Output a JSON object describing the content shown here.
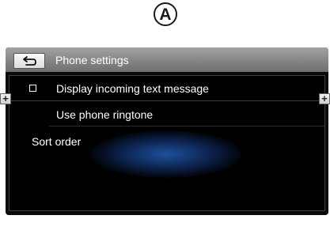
{
  "marker": {
    "label": "A"
  },
  "header": {
    "title": "Phone settings",
    "back_icon": "back-arrow-icon"
  },
  "menu": {
    "items": [
      {
        "label": "Display incoming text message",
        "checked": false
      },
      {
        "label": "Use phone ringtone"
      },
      {
        "label": "Sort order"
      }
    ]
  },
  "side_buttons": {
    "left": "+",
    "right": "+"
  },
  "colors": {
    "screen_background": "#0b0b0b",
    "titlebar": "#8a8a8a",
    "highlight_glow": "#235fb9"
  }
}
